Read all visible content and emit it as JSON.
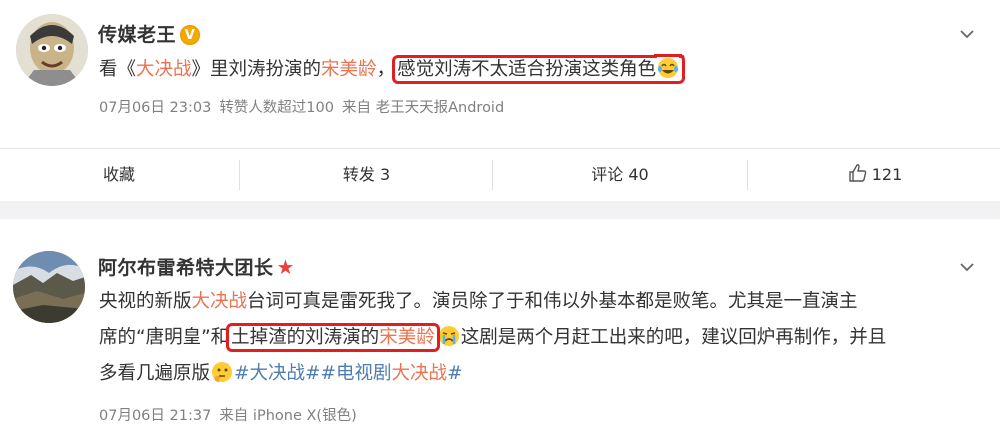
{
  "posts": [
    {
      "username": "传媒老王",
      "badge": "V",
      "text": {
        "p1": "看《",
        "tag1": "大决战",
        "p2": "》里刘涛扮演的",
        "tag2": "宋美龄",
        "p3": "，",
        "boxed": "感觉刘涛不太适合扮演这类角色"
      },
      "meta": {
        "date": "07月06日 23:03",
        "reposts_note": "转赞人数超过100",
        "source": "来自 老王天天报Android"
      },
      "actions": {
        "favorite": "收藏",
        "repost": "转发 3",
        "comment": "评论 40",
        "like": "121"
      }
    },
    {
      "username": "阿尔布雷希特大团长",
      "text": {
        "l1a": "央视的新版",
        "l1tag": "大决战",
        "l1b": "台词可真是雷死我了。演员除了于和伟以外基本都是败笔。尤其是一直演主",
        "l2a": "席的“唐明皇”和",
        "l2box1": "土掉渣的刘涛演的",
        "l2box2": "宋美龄",
        "l2b": "这剧是两个月赶工出来的吧，建议回炉再制作，并且",
        "l3a": "多看几遍原版",
        "hashtag1": "#大决战#",
        "hashtag2a": "#电视剧",
        "hashtag2b": "大决战",
        "hashtag2c": "#"
      },
      "meta": {
        "date": "07月06日 21:37",
        "source": "来自 iPhone X(银色)"
      }
    }
  ],
  "colors": {
    "link_orange": "#eb7350",
    "hashtag_blue": "#507daf",
    "highlight_box": "#e02020",
    "badge_gold": "#f2a900"
  },
  "icons": [
    "chevron-down-icon",
    "crying-laughing-emoji",
    "crying-emoji",
    "thinking-emoji",
    "thumbs-up-icon",
    "verified-v-badge",
    "star-badge"
  ]
}
